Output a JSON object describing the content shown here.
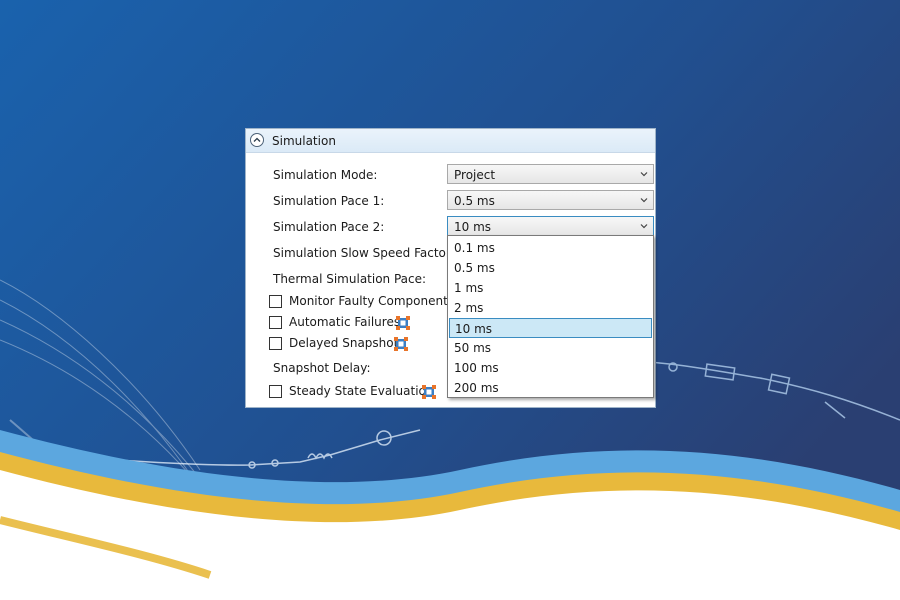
{
  "panel": {
    "title": "Simulation",
    "collapse_icon": "chevron-up-icon",
    "fields": [
      {
        "label": "Simulation Mode:",
        "value": "Project"
      },
      {
        "label": "Simulation Pace 1:",
        "value": "0.5 ms"
      },
      {
        "label": "Simulation Pace 2:",
        "value": "10 ms"
      },
      {
        "label": "Simulation Slow Speed Factor:"
      },
      {
        "label": "Thermal Simulation Pace:"
      }
    ],
    "checkboxes": [
      {
        "label": "Monitor Faulty Components",
        "checked": false
      },
      {
        "label": "Automatic Failures",
        "checked": false,
        "icon": "failure-config-icon"
      },
      {
        "label": "Delayed Snapshot",
        "checked": false,
        "icon": "failure-config-icon"
      }
    ],
    "snapshot_delay_label": "Snapshot Delay:",
    "steady_state": {
      "label": "Steady State Evaluation",
      "checked": false,
      "icon": "failure-config-icon"
    }
  },
  "dropdown": {
    "options": [
      "0.1 ms",
      "0.5 ms",
      "1 ms",
      "2 ms",
      "10 ms",
      "50 ms",
      "100 ms",
      "200 ms"
    ],
    "selected": "10 ms"
  },
  "colors": {
    "background_blue": "#1f5aa0",
    "wave_gold": "#e8b93c",
    "wave_light_blue": "#5ca7df",
    "selection_bg": "#cce8f6",
    "selection_border": "#3a8cc1"
  }
}
